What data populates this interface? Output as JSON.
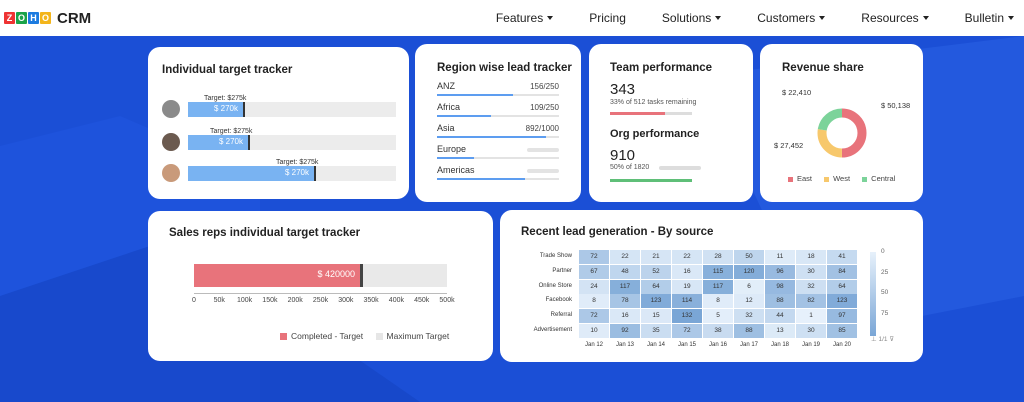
{
  "nav": {
    "brand": "ZOHO",
    "product": "CRM",
    "items": [
      "Features",
      "Pricing",
      "Solutions",
      "Customers",
      "Resources",
      "Bulletin"
    ]
  },
  "itt": {
    "title": "Individual target tracker",
    "reps": [
      {
        "target": "Target: $275k",
        "value": "$ 270k"
      },
      {
        "target": "Target: $275k",
        "value": "$ 270k"
      },
      {
        "target": "Target: $275k",
        "value": "$ 270k"
      }
    ]
  },
  "region": {
    "title": "Region wise lead tracker",
    "rows": [
      {
        "name": "ANZ",
        "val": "156/250",
        "pct": 0.62
      },
      {
        "name": "Africa",
        "val": "109/250",
        "pct": 0.44
      },
      {
        "name": "Asia",
        "val": "892/1000",
        "pct": 0.89
      },
      {
        "name": "Europe",
        "val": "",
        "pct": 0.3
      },
      {
        "name": "Americas",
        "val": "",
        "pct": 0.72
      }
    ]
  },
  "team": {
    "title": "Team performance",
    "value": "343",
    "note": "33% of 512 tasks remaining",
    "org_title": "Org performance",
    "org_value": "910",
    "org_note": "50% of 1820"
  },
  "revenue": {
    "title": "Revenue share",
    "labels": [
      "$ 22,410",
      "$ 50,138",
      "$ 27,452"
    ],
    "legend": [
      "East",
      "West",
      "Central"
    ],
    "colors": [
      "#e8737b",
      "#f7c86c",
      "#7cd39a"
    ]
  },
  "sales": {
    "title": "Sales reps individual target tracker",
    "bar_value": "$ 420000",
    "ticks": [
      "0",
      "50k",
      "100k",
      "150k",
      "200k",
      "250k",
      "300k",
      "350k",
      "400k",
      "450k",
      "500k"
    ],
    "legend": [
      "Completed - Target",
      "Maximum Target"
    ]
  },
  "recent": {
    "title": "Recent lead generation - By source",
    "rows": [
      "Trade Show",
      "Partner",
      "Online Store",
      "Facebook",
      "Referral",
      "Advertisement"
    ],
    "cols": [
      "Jan 12",
      "Jan 13",
      "Jan 14",
      "Jan 15",
      "Jan 16",
      "Jan 17",
      "Jan 18",
      "Jan 19",
      "Jan 20"
    ],
    "cells": [
      [
        72,
        22,
        21,
        22,
        28,
        50,
        11,
        18,
        41
      ],
      [
        67,
        48,
        52,
        16,
        115,
        120,
        96,
        30,
        84
      ],
      [
        24,
        117,
        64,
        19,
        117,
        6,
        98,
        32,
        64
      ],
      [
        8,
        78,
        123,
        114,
        8,
        12,
        88,
        82,
        123
      ],
      [
        72,
        16,
        15,
        132,
        5,
        32,
        44,
        1,
        97
      ],
      [
        10,
        92,
        35,
        72,
        38,
        88,
        13,
        30,
        85
      ]
    ],
    "scale": [
      "0",
      "25",
      "50",
      "75"
    ],
    "pager": "1/1"
  }
}
